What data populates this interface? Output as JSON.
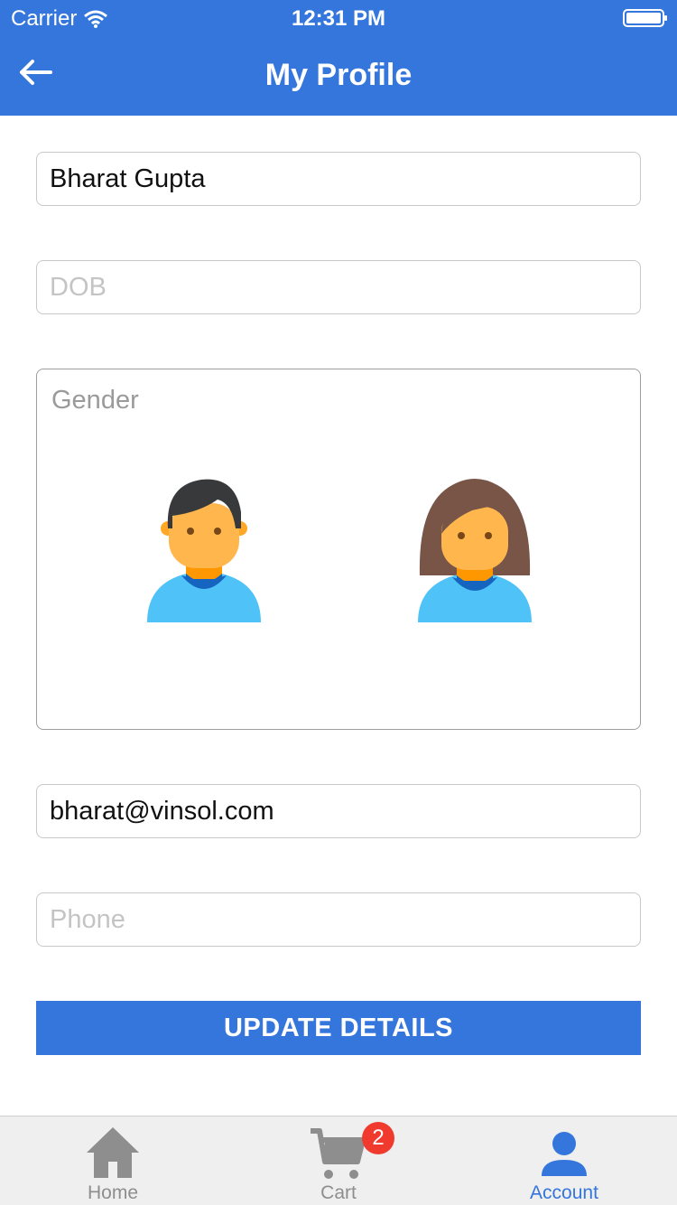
{
  "status_bar": {
    "carrier": "Carrier",
    "time": "12:31 PM"
  },
  "header": {
    "title": "My Profile",
    "back_icon": "arrow-left-icon"
  },
  "form": {
    "name": {
      "value": "Bharat Gupta",
      "placeholder": ""
    },
    "dob": {
      "value": "",
      "placeholder": "DOB"
    },
    "gender": {
      "label": "Gender",
      "options": [
        {
          "name": "male",
          "icon": "male-avatar-icon"
        },
        {
          "name": "female",
          "icon": "female-avatar-icon"
        }
      ]
    },
    "email": {
      "value": "bharat@vinsol.com",
      "placeholder": ""
    },
    "phone": {
      "value": "",
      "placeholder": "Phone"
    },
    "submit_label": "UPDATE DETAILS"
  },
  "tabs": [
    {
      "label": "Home",
      "icon": "home-icon",
      "active": false
    },
    {
      "label": "Cart",
      "icon": "cart-icon",
      "active": false,
      "badge": "2"
    },
    {
      "label": "Account",
      "icon": "user-icon",
      "active": true
    }
  ],
  "colors": {
    "primary": "#3476dc",
    "tab_inactive": "#8e8e8e",
    "badge": "#f03a2e",
    "avatar_shirt": "#4fc3f7",
    "avatar_skin": "#ffb74d",
    "female_hair": "#795548",
    "male_hair": "#37393b"
  }
}
